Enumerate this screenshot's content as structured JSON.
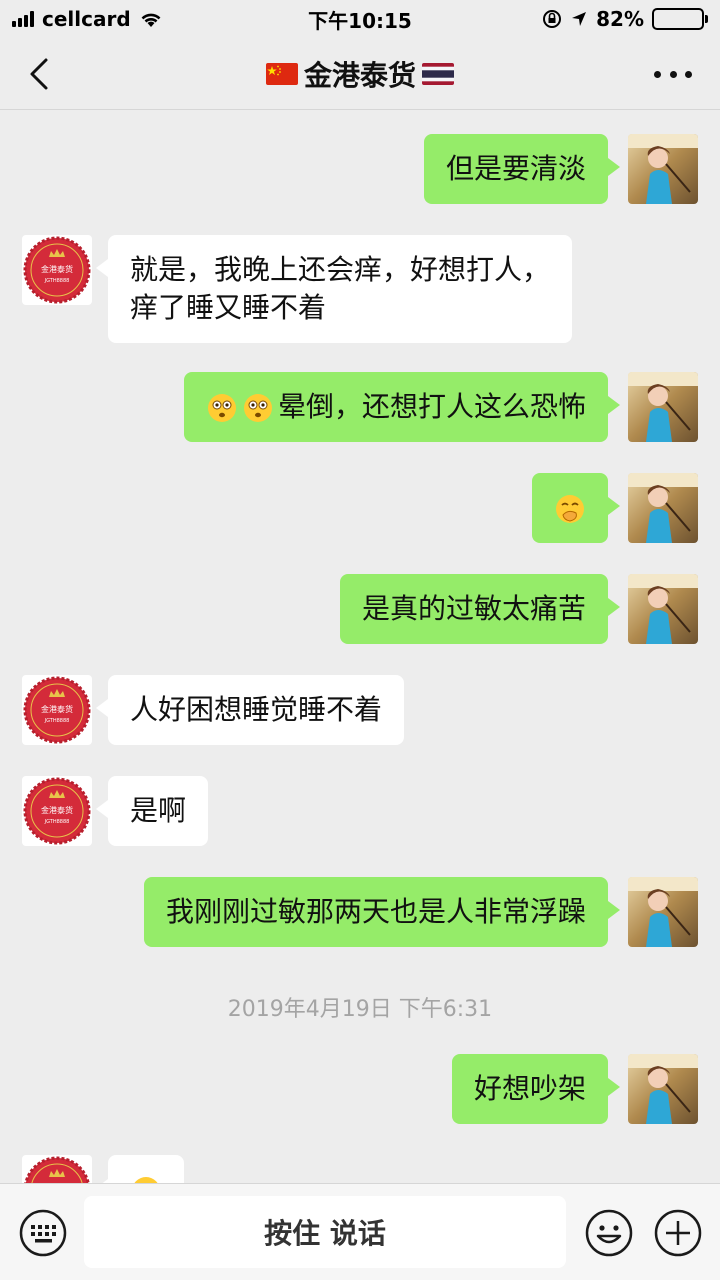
{
  "status_bar": {
    "carrier": "cellcard",
    "time": "下午10:15",
    "battery_percent": "82%",
    "battery_level": 0.82
  },
  "header": {
    "title": "金港泰货"
  },
  "contact_avatar_text": {
    "line1": "金港泰货",
    "line2": "JGTH8888"
  },
  "messages": [
    {
      "side": "right",
      "text": "但是要清淡"
    },
    {
      "side": "left",
      "text_line1": "就是，我晚上还会痒，好想打人，",
      "text_line2": "痒了睡又睡不着"
    },
    {
      "side": "right",
      "text": "晕倒，还想打人这么恐怖",
      "emoji": "flushed-face ×2"
    },
    {
      "side": "right",
      "emoji": "face-with-hand-over-mouth"
    },
    {
      "side": "right",
      "text": "是真的过敏太痛苦"
    },
    {
      "side": "left",
      "text": "人好困想睡觉睡不着"
    },
    {
      "side": "left",
      "text": "是啊"
    },
    {
      "side": "right",
      "text": "我刚刚过敏那两天也是人非常浮躁"
    },
    {
      "side": "right",
      "text": "好想吵架"
    },
    {
      "side": "left",
      "emoji": "face-partially-visible"
    }
  ],
  "timestamp": "2019年4月19日 下午6:31",
  "input_bar": {
    "hold_to_talk": "按住 说话"
  },
  "colors": {
    "background": "#ededed",
    "sent_bubble": "#95ec69",
    "received_bubble": "#ffffff",
    "contact_avatar_red": "#d42b3a",
    "avatar_gold": "#e8c34a"
  }
}
